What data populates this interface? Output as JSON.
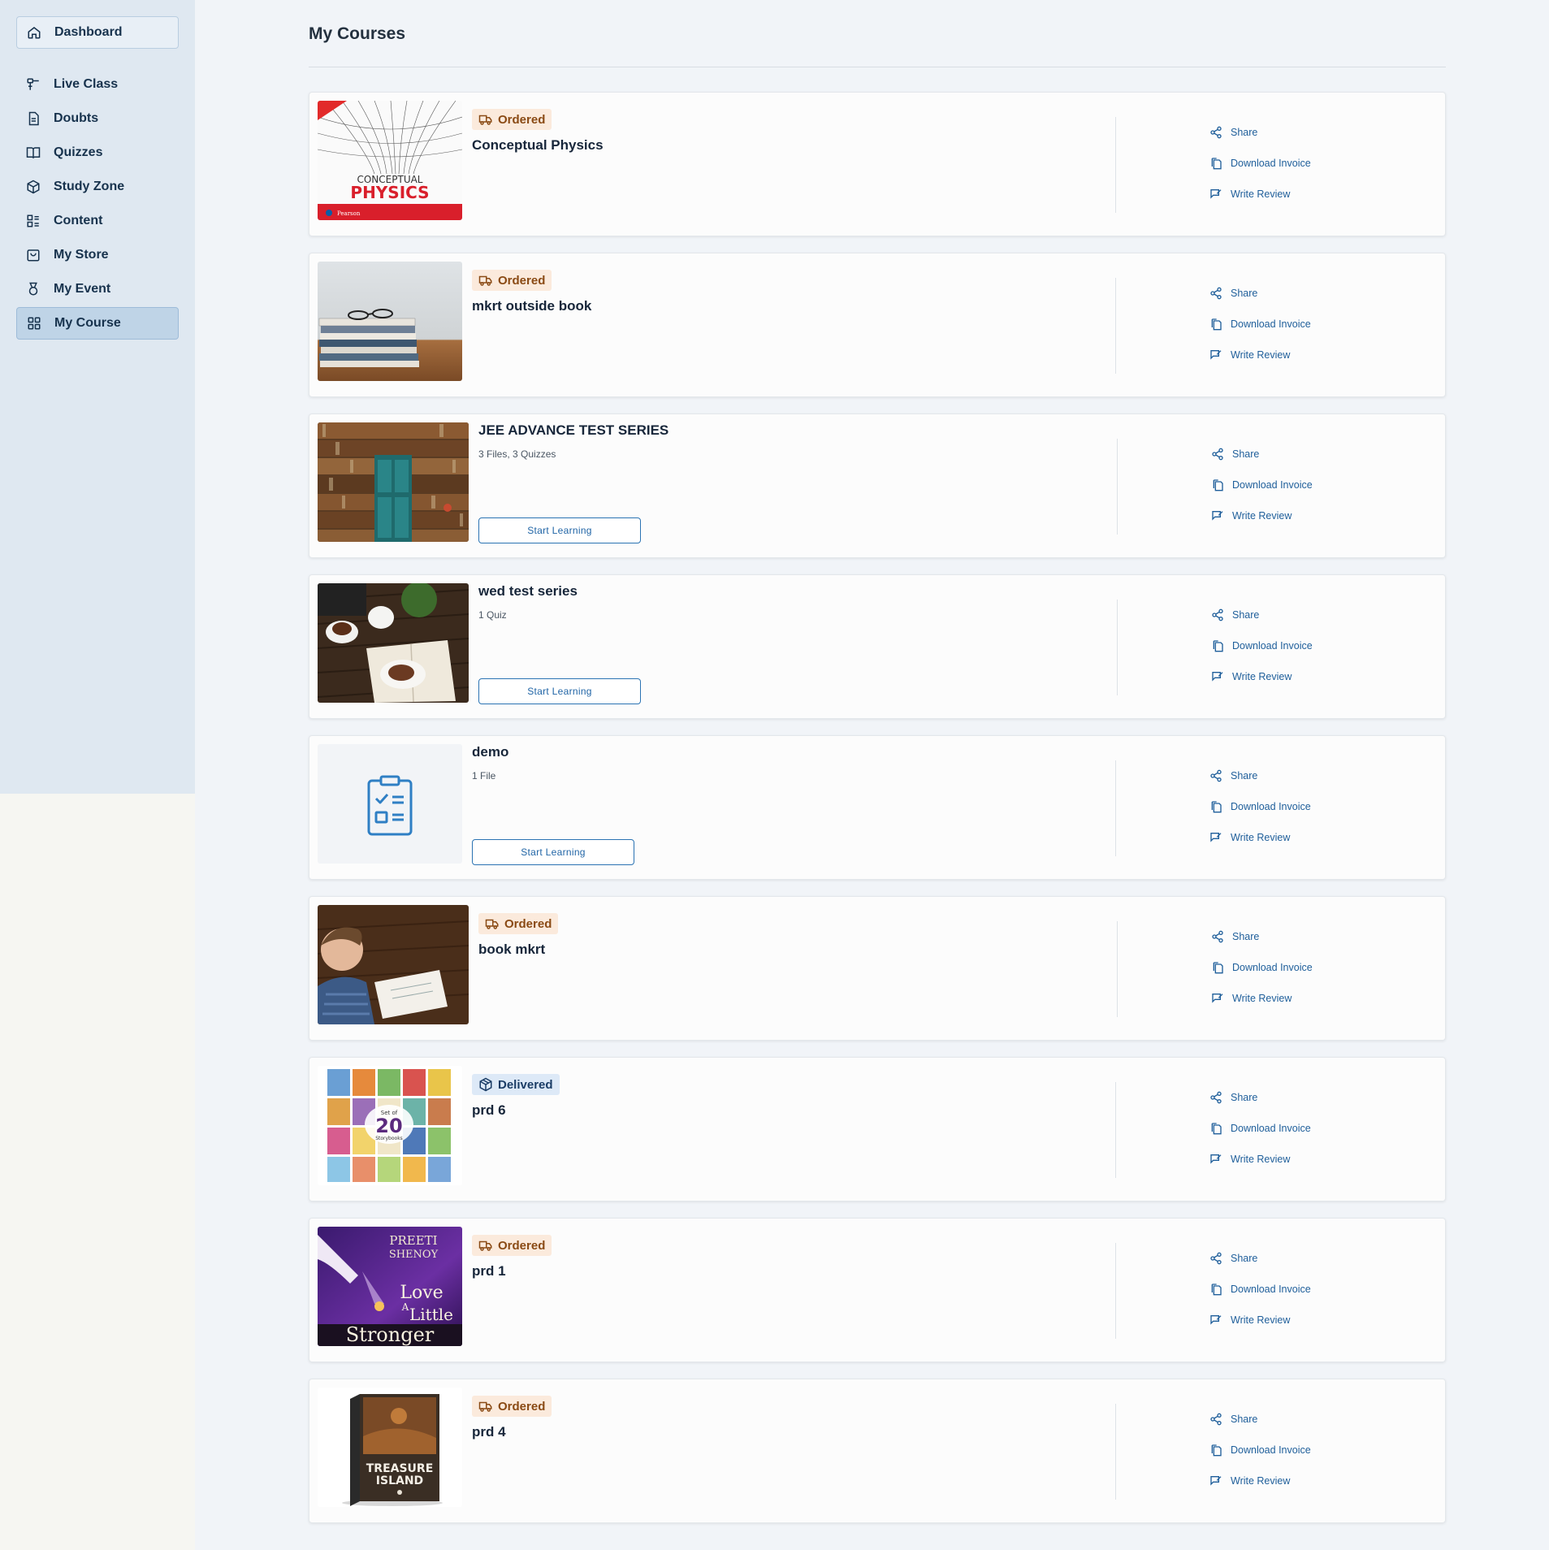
{
  "sidebar": {
    "items": [
      {
        "label": "Dashboard",
        "icon": "home-icon"
      },
      {
        "label": "Live Class",
        "icon": "live-class-icon"
      },
      {
        "label": "Doubts",
        "icon": "document-icon"
      },
      {
        "label": "Quizzes",
        "icon": "book-icon"
      },
      {
        "label": "Study Zone",
        "icon": "cube-icon"
      },
      {
        "label": "Content",
        "icon": "content-grid-icon"
      },
      {
        "label": "My Store",
        "icon": "store-icon"
      },
      {
        "label": "My Event",
        "icon": "medal-icon"
      },
      {
        "label": "My Course",
        "icon": "grid-icon"
      }
    ],
    "active": "My Course"
  },
  "page": {
    "title": "My Courses"
  },
  "courses": [
    {
      "name": "Conceptual Physics",
      "status": "Ordered",
      "image": "conceptual-physics-cover"
    },
    {
      "name": "mkrt outside book",
      "status": "Ordered",
      "image": "stacked-books-photo"
    },
    {
      "name": "JEE ADVANCE TEST SERIES",
      "meta": "3 Files, 3 Quizzes",
      "button": "Start Learning",
      "image": "bookshelf-door-photo"
    },
    {
      "name": "wed test series",
      "meta": "1 Quiz",
      "button": "Start Learning",
      "image": "tea-and-book-photo"
    },
    {
      "name": "demo",
      "meta": "1 File",
      "button": "Start Learning",
      "image": "clipboard-icon"
    },
    {
      "name": "book mkrt",
      "status": "Ordered",
      "image": "child-reading-photo"
    },
    {
      "name": "prd 6",
      "status": "Delivered",
      "image": "storybooks-set-cover"
    },
    {
      "name": "prd 1",
      "status": "Ordered",
      "image": "love-a-little-stronger-cover"
    },
    {
      "name": "prd 4",
      "status": "Ordered",
      "image": "treasure-island-cover"
    }
  ],
  "actions": {
    "share": "Share",
    "download_invoice": "Download Invoice",
    "write_review": "Write Review"
  },
  "covers": {
    "physics": {
      "line1": "CONCEPTUAL",
      "line2": "PHYSICS",
      "publisher": "Pearson"
    },
    "storybooks": {
      "top": "Set of",
      "number": "20",
      "bottom": "Storybooks"
    },
    "love": {
      "author1": "PREETI",
      "author2": "SHENOY",
      "t1": "Love",
      "t2": "A",
      "t3": "Little",
      "t4": "Stronger"
    },
    "treasure": {
      "t1": "TREASURE",
      "t2": "ISLAND"
    }
  },
  "colors": {
    "sidebar_bg": "#dfe8f1",
    "active_nav": "#bfd4e7",
    "accent": "#2165a6",
    "ordered_badge_bg": "#fbeadc",
    "delivered_badge_bg": "#dde9f7"
  }
}
